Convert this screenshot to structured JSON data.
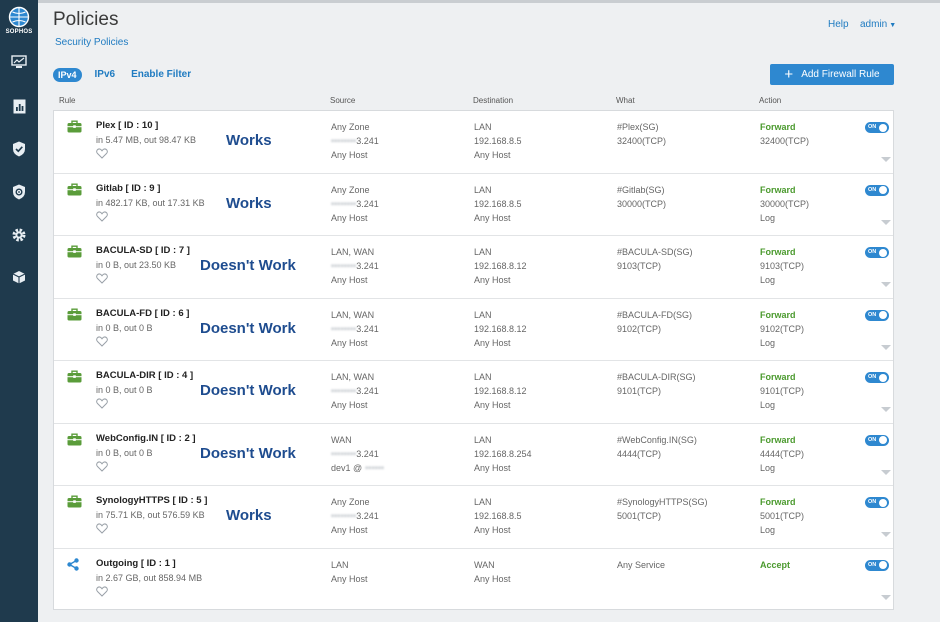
{
  "brand": {
    "logo_text": "SOPHOS"
  },
  "sidebar": {
    "items": [
      {
        "icon": "monitor-icon"
      },
      {
        "icon": "report-icon"
      },
      {
        "icon": "shield-check-icon"
      },
      {
        "icon": "shield-gear-icon"
      },
      {
        "icon": "gear-icon"
      },
      {
        "icon": "cube-icon"
      }
    ]
  },
  "header": {
    "title": "Policies",
    "breadcrumb": "Security Policies",
    "help": "Help",
    "user": "admin"
  },
  "filters": {
    "ipv4": "IPv4",
    "ipv6": "IPv6",
    "enable_filter": "Enable Filter"
  },
  "toolbar": {
    "add_rule": "Add Firewall Rule"
  },
  "columns": {
    "rule": "Rule",
    "source": "Source",
    "destination": "Destination",
    "what": "What",
    "action": "Action"
  },
  "colors": {
    "accent": "#2e88d0",
    "forward": "#4b9a2e",
    "status_text": "#1e4c8f",
    "sidebar": "#1f3a4d"
  },
  "rules": [
    {
      "icon": "briefcase-icon",
      "name": "Plex [ ID : 10 ]",
      "traffic": "in 5.47 MB, out 98.47 KB",
      "status": "Works",
      "source": [
        "Any Zone",
        "3.241",
        "Any Host"
      ],
      "destination": [
        "LAN",
        "192.168.8.5",
        "Any Host"
      ],
      "what": [
        "#Plex(SG)",
        "32400(TCP)"
      ],
      "action": [
        "Forward",
        "32400(TCP)",
        ""
      ],
      "toggle": "ON"
    },
    {
      "icon": "briefcase-icon",
      "name": "Gitlab [ ID : 9 ]",
      "traffic": "in 482.17 KB, out 17.31 KB",
      "status": "Works",
      "source": [
        "Any Zone",
        "3.241",
        "Any Host"
      ],
      "destination": [
        "LAN",
        "192.168.8.5",
        "Any Host"
      ],
      "what": [
        "#Gitlab(SG)",
        "30000(TCP)"
      ],
      "action": [
        "Forward",
        "30000(TCP)",
        "Log"
      ],
      "toggle": "ON"
    },
    {
      "icon": "briefcase-icon",
      "name": "BACULA-SD [ ID : 7 ]",
      "traffic": "in 0 B, out 23.50 KB",
      "status": "Doesn't Work",
      "source": [
        "LAN, WAN",
        "3.241",
        "Any Host"
      ],
      "destination": [
        "LAN",
        "192.168.8.12",
        "Any Host"
      ],
      "what": [
        "#BACULA-SD(SG)",
        "9103(TCP)"
      ],
      "action": [
        "Forward",
        "9103(TCP)",
        "Log"
      ],
      "toggle": "ON"
    },
    {
      "icon": "briefcase-icon",
      "name": "BACULA-FD [ ID : 6 ]",
      "traffic": "in 0 B, out 0 B",
      "status": "Doesn't Work",
      "source": [
        "LAN, WAN",
        "3.241",
        "Any Host"
      ],
      "destination": [
        "LAN",
        "192.168.8.12",
        "Any Host"
      ],
      "what": [
        "#BACULA-FD(SG)",
        "9102(TCP)"
      ],
      "action": [
        "Forward",
        "9102(TCP)",
        "Log"
      ],
      "toggle": "ON"
    },
    {
      "icon": "briefcase-icon",
      "name": "BACULA-DIR [ ID : 4 ]",
      "traffic": "in 0 B, out 0 B",
      "status": "Doesn't Work",
      "source": [
        "LAN, WAN",
        "3.241",
        "Any Host"
      ],
      "destination": [
        "LAN",
        "192.168.8.12",
        "Any Host"
      ],
      "what": [
        "#BACULA-DIR(SG)",
        "9101(TCP)"
      ],
      "action": [
        "Forward",
        "9101(TCP)",
        "Log"
      ],
      "toggle": "ON"
    },
    {
      "icon": "briefcase-icon",
      "name": "WebConfig.IN [ ID : 2 ]",
      "traffic": "in 0 B, out 0 B",
      "status": "Doesn't Work",
      "source": [
        "WAN",
        "3.241",
        "dev1 @"
      ],
      "destination": [
        "LAN",
        "192.168.8.254",
        "Any Host"
      ],
      "what": [
        "#WebConfig.IN(SG)",
        "4444(TCP)"
      ],
      "action": [
        "Forward",
        "4444(TCP)",
        "Log"
      ],
      "toggle": "ON"
    },
    {
      "icon": "briefcase-icon",
      "name": "SynologyHTTPS [ ID : 5 ]",
      "traffic": "in 75.71 KB, out 576.59 KB",
      "status": "Works",
      "source": [
        "Any Zone",
        "3.241",
        "Any Host"
      ],
      "destination": [
        "LAN",
        "192.168.8.5",
        "Any Host"
      ],
      "what": [
        "#SynologyHTTPS(SG)",
        "5001(TCP)"
      ],
      "action": [
        "Forward",
        "5001(TCP)",
        "Log"
      ],
      "toggle": "ON"
    },
    {
      "icon": "share-icon",
      "name": "Outgoing [ ID : 1 ]",
      "traffic": "in 2.67 GB, out 858.94 MB",
      "status": "",
      "source": [
        "LAN",
        "Any Host",
        ""
      ],
      "destination": [
        "WAN",
        "Any Host",
        ""
      ],
      "what": [
        "Any Service",
        ""
      ],
      "action": [
        "Accept",
        "",
        ""
      ],
      "toggle": "ON"
    }
  ]
}
